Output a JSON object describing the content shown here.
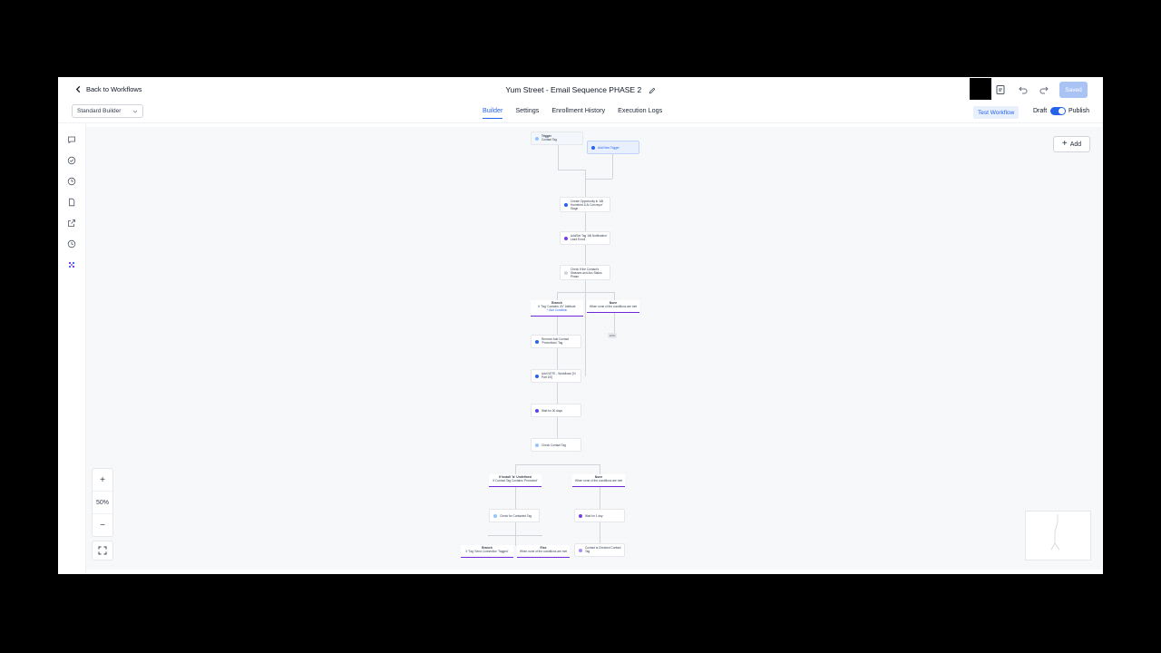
{
  "header": {
    "back_label": "Back to Workflows",
    "title": "Yum Street - Email Sequence PHASE 2",
    "saved_label": "Saved"
  },
  "subheader": {
    "builder_select": "Standard Builder",
    "tabs": [
      {
        "label": "Builder",
        "active": true
      },
      {
        "label": "Settings",
        "active": false
      },
      {
        "label": "Enrollment History",
        "active": false
      },
      {
        "label": "Execution Logs",
        "active": false
      }
    ],
    "test_label": "Test Workflow",
    "draft_label": "Draft",
    "publish_label": "Publish"
  },
  "rail_icons": [
    "chat-icon",
    "check-circle-icon",
    "clock-icon",
    "document-icon",
    "external-link-icon",
    "history-icon",
    "ai-sparkle-icon"
  ],
  "canvas": {
    "add_label": "Add",
    "zoom_level": "50%",
    "nodes": {
      "trigger": {
        "title": "Trigger",
        "sub": "Contact Tag"
      },
      "add_trigger": "Add New Trigger",
      "n1": "Create Opportunity in 'AB Homebird & Ai Conveyor' Stage",
      "n2": "Add/Set Tag 'AB Notification' Lead Enroll",
      "n3": "Check If the Contact's Statuses and Acc Status Phase",
      "b1": {
        "title": "Branch",
        "sub": "If 'Tag' Contains 'AY' Attribute",
        "link": "+ Add Condition"
      },
      "b2": {
        "title": "None",
        "sub": "When none of the conditions are met"
      },
      "end": "END",
      "n4": "Remove Add Contact 'Promotions' Tag",
      "n5": "Add NOTE - Workflows ['N Part 1B']",
      "n6": "Wait for 30 days",
      "n7": "Check Contact Tag",
      "b3": {
        "title": "If Install 'Is' Undefined",
        "sub": "If Contact Tag Contains 'Promoted'"
      },
      "b4": {
        "title": "None",
        "sub": "When none of the conditions are met"
      },
      "n8": "Check for Contacted Tag",
      "n9": "Wait for 1 day",
      "b5": {
        "title": "Branch",
        "sub": "If 'Tag' Send Connection 'Tagged'"
      },
      "b6": {
        "title": "Else",
        "sub": "When none of the conditions are met"
      },
      "n10": "Contact is Checked Contact Tag"
    }
  },
  "colors": {
    "accent": "#2563eb",
    "branch": "#6d28d9",
    "saved": "#a9c3f5"
  }
}
